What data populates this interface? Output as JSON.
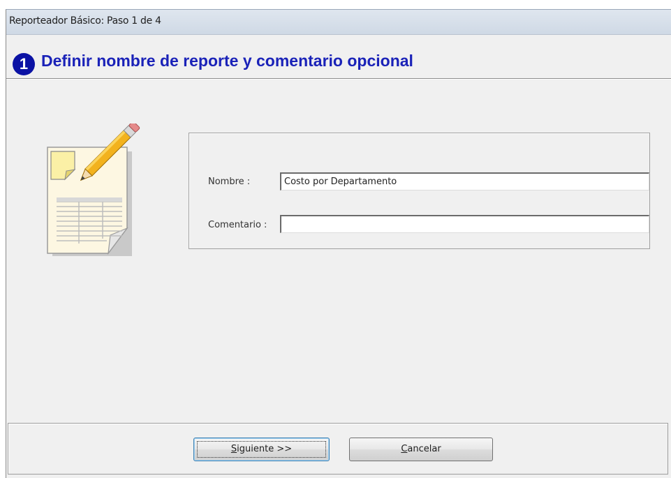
{
  "window": {
    "title": "Reporteador Básico: Paso 1 de 4"
  },
  "header": {
    "step_number": "1",
    "heading": "Definir nombre de reporte y comentario opcional"
  },
  "icons": {
    "report": "report-pencil-icon"
  },
  "form": {
    "nombre_label": "Nombre :",
    "nombre_value": "Costo por Departamento",
    "comentario_label": "Comentario :",
    "comentario_value": ""
  },
  "buttons": {
    "siguiente_mnemonic": "S",
    "siguiente_rest": "iguiente >>",
    "cancelar_mnemonic": "C",
    "cancelar_rest": "ancelar"
  },
  "colors": {
    "heading": "#1a22b8",
    "badge": "#0b12a4",
    "titlebar": "#cfd9e5",
    "background": "#f0f0f0"
  }
}
